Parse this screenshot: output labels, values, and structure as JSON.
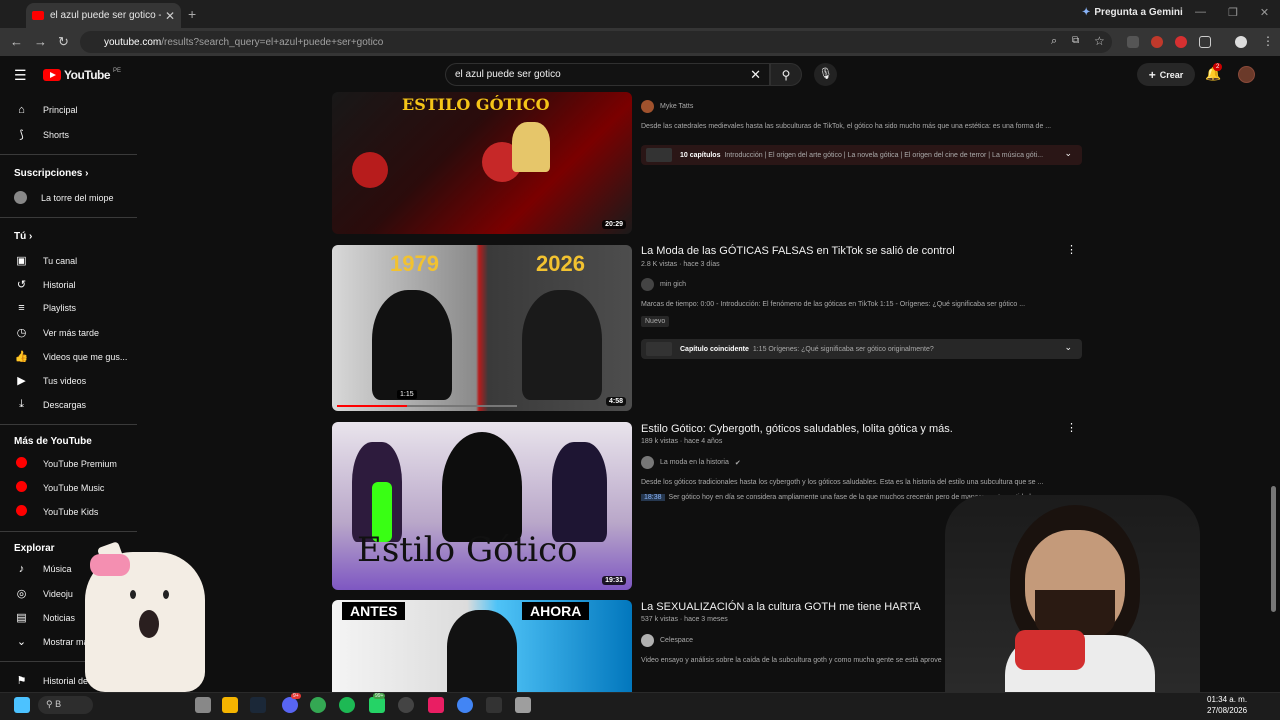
{
  "browser": {
    "tab_title": "el azul puede ser gotico - YouTu",
    "gemini_label": "Pregunta a Gemini",
    "url_domain": "youtube.com",
    "url_path": "/results?search_query=el+azul+puede+ser+gotico"
  },
  "header": {
    "logo_text": "YouTube",
    "logo_country": "PE",
    "search_value": "el azul puede ser gotico",
    "create_label": "Crear",
    "notifications_count": "2"
  },
  "sidebar": {
    "main": [
      {
        "label": "Principal",
        "icon": "home-icon"
      },
      {
        "label": "Shorts",
        "icon": "shorts-icon"
      }
    ],
    "subscriptions_header": "Suscripciones",
    "subscriptions": [
      {
        "label": "La torre del miope"
      }
    ],
    "you_header": "Tú",
    "you_items": [
      {
        "label": "Tu canal",
        "icon": "channel-icon"
      },
      {
        "label": "Historial",
        "icon": "history-icon"
      },
      {
        "label": "Playlists",
        "icon": "playlists-icon"
      },
      {
        "label": "Ver más tarde",
        "icon": "watch-later-icon"
      },
      {
        "label": "Videos que me gus...",
        "icon": "like-icon"
      },
      {
        "label": "Tus videos",
        "icon": "your-videos-icon"
      },
      {
        "label": "Descargas",
        "icon": "download-icon"
      }
    ],
    "more_header": "Más de YouTube",
    "more_items": [
      {
        "label": "YouTube Premium"
      },
      {
        "label": "YouTube Music"
      },
      {
        "label": "YouTube Kids"
      }
    ],
    "explore_header": "Explorar",
    "explore_items": [
      {
        "label": "Música"
      },
      {
        "label": "Videoju"
      },
      {
        "label": "Noticias"
      },
      {
        "label": "Mostrar más"
      },
      {
        "label": "Historial de"
      }
    ]
  },
  "results": [
    {
      "channel": "Myke Tatts",
      "description": "Desde las catedrales medievales hasta las subculturas de TikTok, el gótico ha sido mucho más que una estética: es una forma de ...",
      "chapters_label": "10 capítulos",
      "chapters_text": "Introducción | El origen del arte gótico | La novela gótica | El origen del cine de terror | La música góti...",
      "duration": "20:29",
      "thumb_text": "ESTILO GÓTICO"
    },
    {
      "title": "La Moda de las GÓTICAS FALSAS en TikTok se salió de control",
      "meta": "2.8 K vistas · hace 3 días",
      "channel": "min gich",
      "description": "Marcas de tiempo: 0:00 - Introducción: El fenómeno de las góticas en TikTok 1:15 - Orígenes: ¿Qué significaba ser gótico ...",
      "badge": "Nuevo",
      "chapters_label": "Capítulo coincidente",
      "chapters_text": "1:15 Orígenes: ¿Qué significaba ser gótico originalmente?",
      "duration": "4:58",
      "hover_time": "1:15",
      "thumb_left": "1979",
      "thumb_right": "2026"
    },
    {
      "title": "Estilo Gótico: Cybergoth, góticos saludables, lolita gótica y más.",
      "meta": "189 k vistas · hace 4 años",
      "channel": "La moda en la historia",
      "description": "Desde los góticos tradicionales hasta los cybergoth y los góticos saludables. Esta es la historia del estilo una subcultura que se ...",
      "timestamp": "18:38",
      "timestamp_text": "Ser gótico hoy en día se considera ampliamente una fase de la que muchos crecerán pero de manera controvertida ha",
      "duration": "19:31",
      "thumb_text": "Estilo Gótico"
    },
    {
      "title": "La SEXUALIZACIÓN a la cultura GOTH me tiene HARTA",
      "meta": "537 k vistas · hace 3 meses",
      "channel": "Celespace",
      "description": "Video ensayo y análisis sobre la caída de la subcultura goth y como mucha gente se está aprove",
      "thumb_left": "ANTES",
      "thumb_right": "AHORA"
    }
  ],
  "taskbar": {
    "search_placeholder": "B",
    "time": "01:34 a. m.",
    "date": "27/08/2026",
    "discord_badge": "9+",
    "whatsapp_badge": "99+"
  },
  "colors": {
    "yt_red": "#ff0000",
    "background": "#0f0f0f",
    "chapter_bar": "#3b1f1f"
  }
}
